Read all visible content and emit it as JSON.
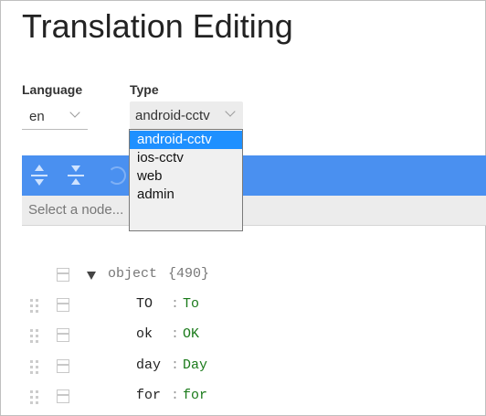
{
  "page": {
    "title": "Translation Editing"
  },
  "language": {
    "label": "Language",
    "value": "en"
  },
  "type": {
    "label": "Type",
    "value": "android-cctv",
    "options": [
      "android-cctv",
      "ios-cctv",
      "web",
      "admin"
    ]
  },
  "toolbar": {
    "accent": "#4a90f0"
  },
  "search": {
    "placeholder": "Select a node..."
  },
  "tree": {
    "root": {
      "label": "object",
      "count": "{490}"
    },
    "rows": [
      {
        "key": "TO",
        "value": "To"
      },
      {
        "key": "ok",
        "value": "OK"
      },
      {
        "key": "day",
        "value": "Day"
      },
      {
        "key": "for",
        "value": "for"
      }
    ]
  }
}
